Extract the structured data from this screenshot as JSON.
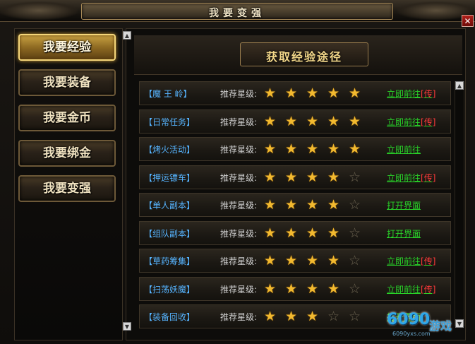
{
  "window": {
    "title": "我要变强",
    "close_label": "✕"
  },
  "menu": {
    "items": [
      {
        "label": "我要经验",
        "active": true
      },
      {
        "label": "我要装备",
        "active": false
      },
      {
        "label": "我要金币",
        "active": false
      },
      {
        "label": "我要绑金",
        "active": false
      },
      {
        "label": "我要变强",
        "active": false
      }
    ]
  },
  "content": {
    "header": "获取经验途径",
    "rows": [
      {
        "name": "【魔 王 岭】",
        "label": "推荐星级:",
        "stars": 5,
        "action": "立即前往",
        "tag": "[传]"
      },
      {
        "name": "【日常任务】",
        "label": "推荐星级:",
        "stars": 5,
        "action": "立即前往",
        "tag": "[传]"
      },
      {
        "name": "【烤火活动】",
        "label": "推荐星级:",
        "stars": 5,
        "action": "立即前往",
        "tag": ""
      },
      {
        "name": "【押运镖车】",
        "label": "推荐星级:",
        "stars": 4,
        "action": "立即前往",
        "tag": "[传]"
      },
      {
        "name": "【单人副本】",
        "label": "推荐星级:",
        "stars": 4,
        "action": "打开界面",
        "tag": ""
      },
      {
        "name": "【组队副本】",
        "label": "推荐星级:",
        "stars": 4,
        "action": "打开界面",
        "tag": ""
      },
      {
        "name": "【草药筹集】",
        "label": "推荐星级:",
        "stars": 4,
        "action": "立即前往",
        "tag": "[传]"
      },
      {
        "name": "【扫荡妖魔】",
        "label": "推荐星级:",
        "stars": 4,
        "action": "立即前往",
        "tag": "[传]"
      },
      {
        "name": "【装备回收】",
        "label": "推荐星级:",
        "stars": 3,
        "action": "打开界面",
        "tag": ""
      }
    ],
    "max_stars": 5
  },
  "watermark": {
    "number": "6090",
    "text": "游戏",
    "url": "6090yxs.com"
  }
}
